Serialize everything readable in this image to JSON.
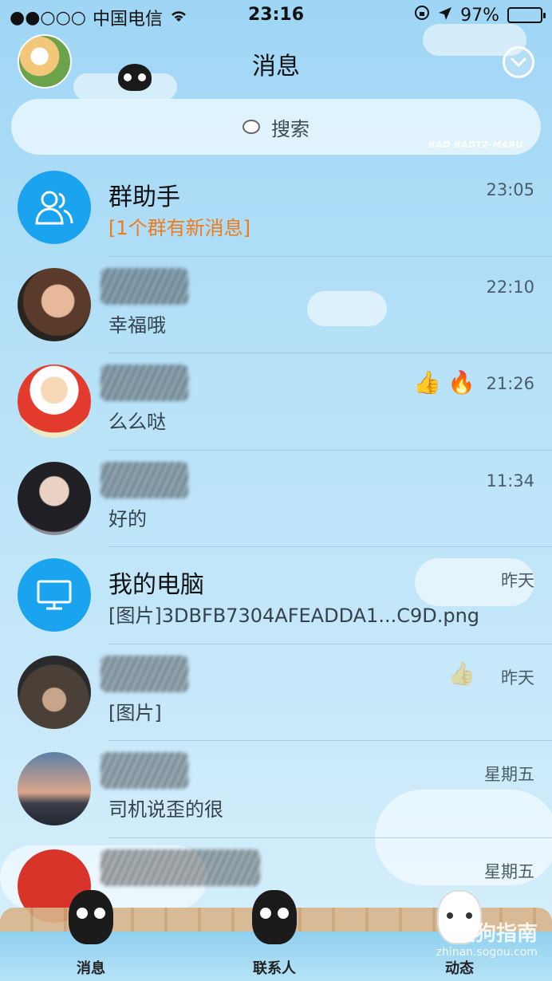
{
  "status_bar": {
    "signal": "●●○○○",
    "carrier": "中国电信",
    "time": "23:16",
    "battery": "97%"
  },
  "header": {
    "title": "消息"
  },
  "search": {
    "label": "搜索",
    "brand": "BAD BADTZ-MARU"
  },
  "conversations": [
    {
      "name": "群助手",
      "preview": "[1个群有新消息]",
      "time": "23:05"
    },
    {
      "name": "",
      "preview": "幸福哦",
      "time": "22:10"
    },
    {
      "name": "",
      "preview": "么么哒",
      "time": "21:26"
    },
    {
      "name": "",
      "preview": "好的",
      "time": "11:34"
    },
    {
      "name": "我的电脑",
      "preview": "[图片]3DBFB7304AFEADDA1...C9D.png",
      "time": "昨天"
    },
    {
      "name": "",
      "preview": "[图片]",
      "time": "昨天"
    },
    {
      "name": "",
      "preview": "司机说歪的很",
      "time": "星期五"
    },
    {
      "name": "",
      "preview": "",
      "time": "星期五"
    }
  ],
  "tabs": {
    "messages": "消息",
    "contacts": "联系人",
    "moments": "动态"
  },
  "watermark": {
    "text": "搜狗指南",
    "url": "zhinan.sogou.com"
  },
  "colors": {
    "accent": "#1aa3ee",
    "alert": "#f07a1a"
  }
}
